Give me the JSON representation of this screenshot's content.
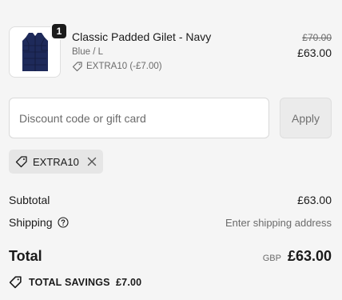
{
  "product": {
    "quantity": "1",
    "title": "Classic Padded Gilet - Navy",
    "variant": "Blue / L",
    "discount_line": "EXTRA10 (-£7.00)",
    "original_price": "£70.00",
    "price": "£63.00",
    "image_icon": "navy-gilet-image"
  },
  "discount": {
    "placeholder": "Discount code or gift card",
    "value": "",
    "apply_label": "Apply",
    "applied_code": "EXTRA10"
  },
  "summary": {
    "subtotal_label": "Subtotal",
    "subtotal_value": "£63.00",
    "shipping_label": "Shipping",
    "shipping_value": "Enter shipping address",
    "total_label": "Total",
    "currency": "GBP",
    "total_value": "£63.00",
    "savings_text": "TOTAL SAVINGS  £7.00"
  },
  "colors": {
    "background": "#f5f5f5",
    "text": "#1a1a1a",
    "muted": "#6b6b6b",
    "gilet": "#1e2a5a"
  }
}
